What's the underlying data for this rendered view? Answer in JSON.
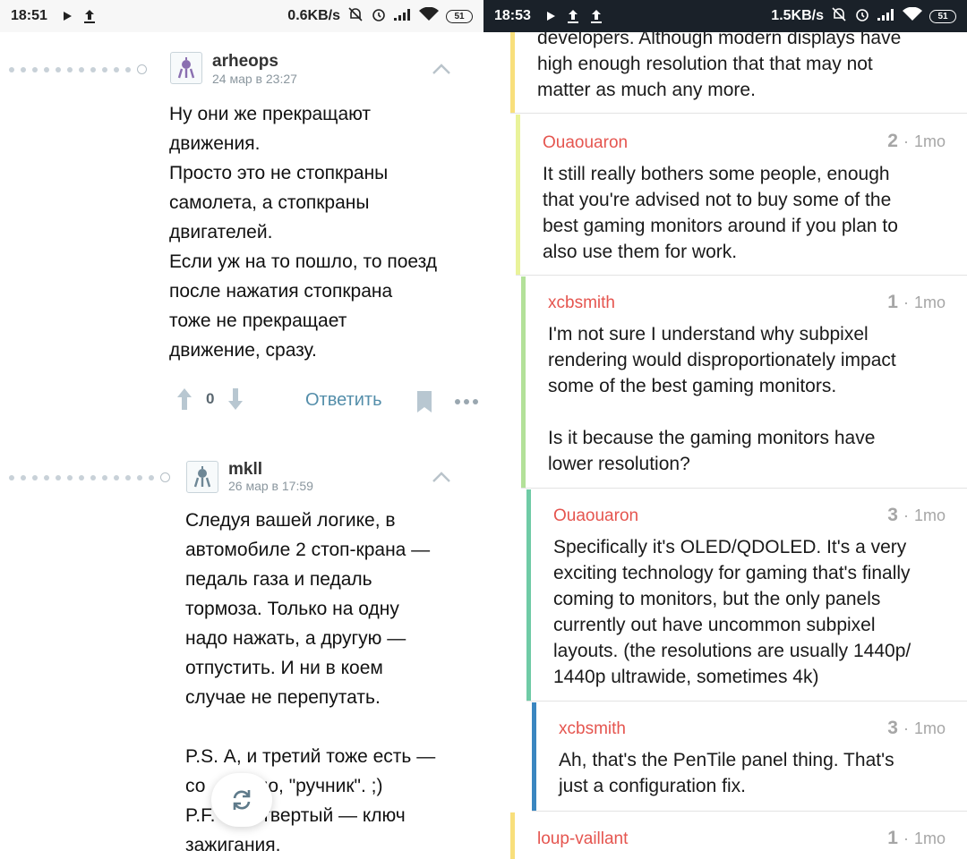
{
  "left": {
    "status": {
      "time": "18:51",
      "speed": "0.6KB/s",
      "battery": "51"
    },
    "comments": [
      {
        "author": "arheops",
        "date": "24 мар в 23:27",
        "lines": [
          "Ну они же прекращают",
          "движения.",
          "Просто это не стопкраны",
          "самолета, а стопкраны",
          "двигателей.",
          "Если уж на то пошло, то поезд",
          "после нажатия стопкрана",
          "тоже не прекращает",
          "движение, сразу."
        ],
        "score": "0",
        "reply_label": "Ответить"
      },
      {
        "author": "mkll",
        "date": "26 мар в 17:59",
        "lines": [
          "Следуя вашей логике, в",
          "автомобиле 2 стоп-крана —",
          "педаль газа и педаль",
          "тормоза. Только на одну",
          "надо нажать, а другую —",
          "отпустить. И ни в коем",
          "случае не перепутать.",
          "",
          "P.S. А, и третий тоже есть —",
          "со          но, \"ручник\". ;)",
          "P.F.       етвертый — ключ",
          "зажигания."
        ]
      }
    ]
  },
  "right": {
    "status": {
      "time": "18:53",
      "speed": "1.5KB/s",
      "battery": "51"
    },
    "colors": {
      "author": "#e5554f",
      "meta": "#a6a6a6"
    },
    "top_fragment": {
      "lines": [
        "developers. Although modern displays have",
        "high enough resolution that that may not",
        "matter as much any more."
      ],
      "bar_color": "#f8df7b"
    },
    "comments": [
      {
        "author": "Ouaouaron",
        "votes": "2",
        "age": "1mo",
        "bar_color": "#e9f39a",
        "lines": [
          "It still really bothers some people, enough",
          "that you're advised not to buy some of the",
          "best gaming monitors around if you plan to",
          "also use them for work."
        ]
      },
      {
        "author": "xcbsmith",
        "votes": "1",
        "age": "1mo",
        "bar_color": "#b3e199",
        "lines": [
          "I'm not sure I understand why subpixel",
          "rendering would disproportionately impact",
          "some of the best gaming monitors.",
          "",
          "Is it because the gaming monitors have",
          "lower resolution?"
        ]
      },
      {
        "author": "Ouaouaron",
        "votes": "3",
        "age": "1mo",
        "bar_color": "#6fcba6",
        "lines": [
          "Specifically it's OLED/QDOLED. It's a very",
          "exciting technology for gaming that's finally",
          "coming to monitors, but the only panels",
          "currently out have uncommon subpixel",
          "layouts. (the resolutions are usually 1440p/",
          "1440p ultrawide, sometimes 4k)"
        ]
      },
      {
        "author": "xcbsmith",
        "votes": "3",
        "age": "1mo",
        "bar_color": "#3a86c0",
        "lines": [
          "Ah, that's the PenTile panel thing. That's",
          "just a configuration fix."
        ]
      },
      {
        "author": "loup-vaillant",
        "votes": "1",
        "age": "1mo",
        "bar_color": "#f8df7b",
        "lines": []
      }
    ]
  }
}
